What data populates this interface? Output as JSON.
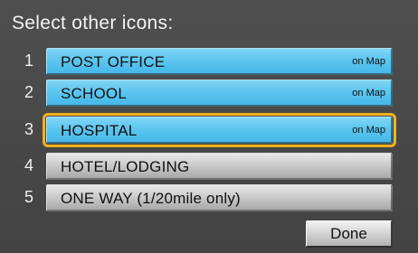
{
  "header": {
    "title": "Select other icons:"
  },
  "items": [
    {
      "number": "1",
      "label": "POST OFFICE",
      "status": "on Map",
      "on_map": true,
      "selected": false
    },
    {
      "number": "2",
      "label": "SCHOOL",
      "status": "on Map",
      "on_map": true,
      "selected": false
    },
    {
      "number": "3",
      "label": "HOSPITAL",
      "status": "on Map",
      "on_map": true,
      "selected": true
    },
    {
      "number": "4",
      "label": "HOTEL/LODGING",
      "status": "",
      "on_map": false,
      "selected": false
    },
    {
      "number": "5",
      "label": "ONE WAY (1/20mile only)",
      "status": "",
      "on_map": false,
      "selected": false
    }
  ],
  "footer": {
    "done_label": "Done"
  },
  "colors": {
    "background": "#4a4a4a",
    "item_on_map": "#5ec6ef",
    "item_off": "#c9c9c9",
    "selection_outline": "#f0b21c",
    "text_light": "#f4f4f4",
    "text_dark": "#111111"
  }
}
